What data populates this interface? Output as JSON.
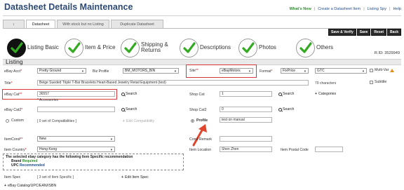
{
  "header": {
    "title": "Datasheet Details Maintenance",
    "whats_new": "What's New",
    "links": [
      "Create a Datasheet Item",
      "Listing Spy",
      "Help"
    ],
    "separator": "|"
  },
  "tabs": [
    {
      "label": "↕"
    },
    {
      "label": "Datasheet"
    },
    {
      "label": "With stock but no Listing"
    },
    {
      "label": "Duplicate Datasheet"
    }
  ],
  "actions": [
    "Save & Verify",
    "Save",
    "Reset",
    "Back"
  ],
  "steps": [
    {
      "label": "Listing Basic"
    },
    {
      "label": "Item & Price"
    },
    {
      "label": "Shipping &\nReturns"
    },
    {
      "label": "Descriptions"
    },
    {
      "label": "Photos"
    },
    {
      "label": "Others"
    }
  ],
  "rid": "R.ID: 3529949",
  "section_title": "Listing",
  "form": {
    "ebay_acct_label": "eBay Acct",
    "ebay_acct_value": "Pretty Ground",
    "biz_profile_label": "Biz Profile",
    "biz_profile_value": "BM_MOTORS_BIN",
    "site_label": "Site",
    "site_value": "eBayMotors",
    "format_label": "Format",
    "format_value": "FixPrice",
    "duration_value": "GTC",
    "multi_var_label": "Multi-Var",
    "title_label": "Title",
    "title_value": "Beige Sueded Triple T-Bar Bracelets Heart-Based Jewelry Retail Equipment (test)",
    "title_chars": "79 characters",
    "subtitle_label": "Subtitle",
    "ebay_cat_label": "eBay Cat",
    "ebay_cat_value": "36557",
    "ebay_cat_note": "* Accessories",
    "search_label": "Search",
    "shop_cat_label": "Shop Cat",
    "shop_cat_value": "1",
    "categories_label": "Categories",
    "ebay_cat2_label": "eBay Cat2",
    "shop_cat2_label": "Shop Cat2",
    "shop_cat2_value": "0",
    "custom_label": "Custom",
    "compat_count": "[ 0 set of Compatibilities ]",
    "edit_compat": "Edit Compatibility",
    "profile_label": "Profile",
    "profile_value": "test on manual",
    "item_cond_label": "ItemCond",
    "item_cond_value": "New",
    "cond_remark_label": "Cond Remark",
    "item_country_label": "Item Country",
    "item_country_value": "Hong Kong",
    "item_location_label": "Item Location",
    "item_location_value": "Shen Zhen",
    "item_postal_label": "Item Postal Code",
    "rec_line1": "The selected ebay category has the following Item Specific recommendation",
    "rec_brand": "Brand",
    "rec_brand_status": "Required",
    "rec_upc": "UPC",
    "rec_upc_status": "Recommended",
    "item_spec_label": "Item Spec",
    "item_spec_value": "[ 3 set of Item Specific ]",
    "edit_item_spec": "Edit Item Spec",
    "ebay_catalog_label": "eBay Catalog/UPC/EAN/ISBN"
  },
  "colors": {
    "title": "#2c4a75",
    "whats_new": "#2e8b2e",
    "highlight_box": "#d9393b",
    "arrow": "#e0452f",
    "check_green": "#33aa22"
  }
}
